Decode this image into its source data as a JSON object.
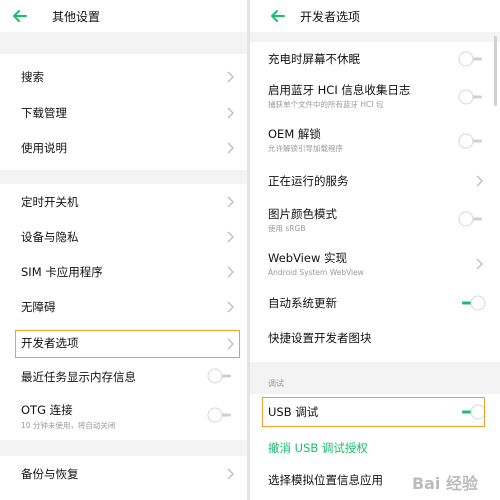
{
  "colors": {
    "accent": "#1bbf6a",
    "highlight": "#f0a030",
    "toggle_off": "#cfcfcf"
  },
  "left": {
    "title": "其他设置",
    "back_icon": "arrow-left-icon",
    "items": [
      {
        "label": "搜索"
      },
      {
        "label": "下载管理"
      },
      {
        "label": "使用说明"
      },
      {
        "label": "定时开关机"
      },
      {
        "label": "设备与隐私"
      },
      {
        "label": "SIM 卡应用程序"
      },
      {
        "label": "无障碍"
      },
      {
        "label": "开发者选项"
      },
      {
        "label": "最近任务显示内存信息",
        "toggle": false
      },
      {
        "label": "OTG 连接",
        "subtitle": "10 分钟未使用，将自动关闭",
        "toggle": false
      },
      {
        "label": "备份与恢复"
      }
    ]
  },
  "right": {
    "title": "开发者选项",
    "items": [
      {
        "label": "充电时屏幕不休眠",
        "toggle": false
      },
      {
        "label": "启用蓝牙 HCI 信息收集日志",
        "subtitle": "捕获单个文件中的所有蓝牙 HCI 包",
        "toggle": false
      },
      {
        "label": "OEM 解锁",
        "subtitle": "允许解锁引导加载程序",
        "toggle": false
      },
      {
        "label": "正在运行的服务"
      },
      {
        "label": "图片颜色模式",
        "subtitle": "使用 sRGB",
        "toggle": false
      },
      {
        "label": "WebView 实现",
        "subtitle": "Android System WebView"
      },
      {
        "label": "自动系统更新",
        "toggle": true
      },
      {
        "label": "快捷设置开发者图块"
      }
    ],
    "section_label": "调试",
    "usb_debug": {
      "label": "USB 调试",
      "toggle": true
    },
    "revoke_label": "撤消 USB 调试授权",
    "mock_location_label": "选择模拟位置信息应用"
  },
  "watermark": "Bai 经验"
}
